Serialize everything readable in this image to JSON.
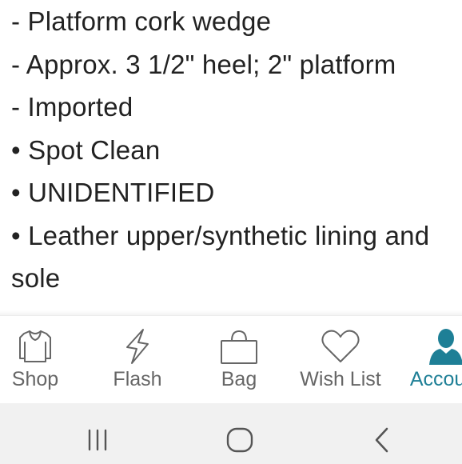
{
  "details": {
    "lines": [
      "- Platform cork wedge",
      "- Approx. 3 1/2\" heel; 2\" platform",
      "- Imported",
      "• Spot Clean",
      "• UNIDENTIFIED",
      "• Leather upper/synthetic lining and sole"
    ]
  },
  "tabbar": {
    "tabs": [
      {
        "label": "Shop",
        "icon": "shirt-icon"
      },
      {
        "label": "Flash",
        "icon": "lightning-icon"
      },
      {
        "label": "Bag",
        "icon": "bag-icon"
      },
      {
        "label": "Wish List",
        "icon": "heart-icon"
      },
      {
        "label": "Account",
        "icon": "person-icon",
        "active": true
      }
    ]
  },
  "system_nav": {
    "buttons": [
      "recents-icon",
      "home-icon",
      "back-icon"
    ]
  },
  "colors": {
    "text": "#222222",
    "tab_label": "#666666",
    "accent": "#1e7f96",
    "nav_bar_bg": "#f1f1f1"
  }
}
